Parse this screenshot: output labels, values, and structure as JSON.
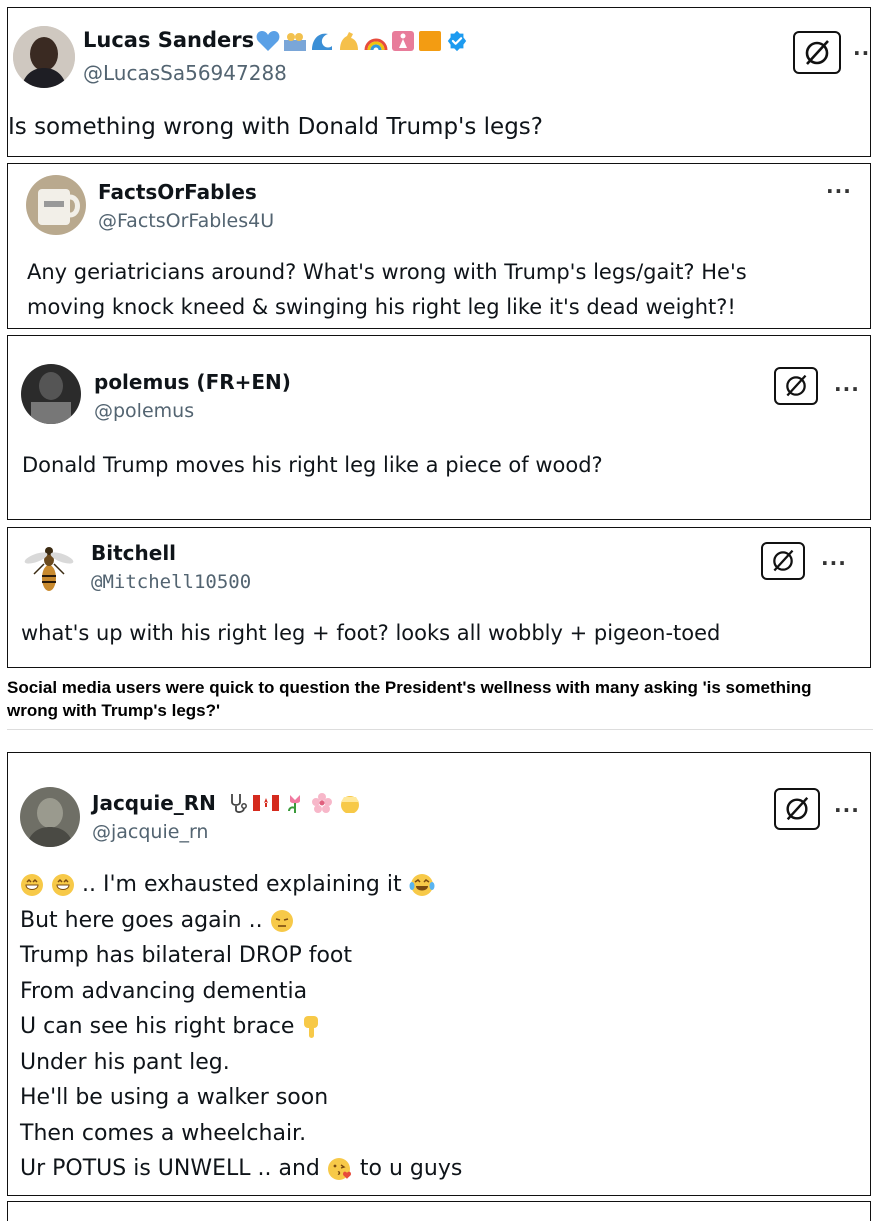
{
  "tweets": [
    {
      "name": "Lucas Sanders",
      "handle": "@LucasSa56947288",
      "text": "Is something wrong with Donald Trump's legs?"
    },
    {
      "name": "FactsOrFables",
      "handle": "@FactsOrFables4U",
      "lines": [
        "Any geriatricians around? What's wrong with Trump's legs/gait? He's",
        "moving knock kneed & swinging his right leg like it's dead weight?!"
      ]
    },
    {
      "name": "polemus (FR+EN)",
      "handle": "@polemus",
      "text": "Donald Trump moves his right leg like a piece of wood?"
    },
    {
      "name": "Bitchell",
      "handle": "@Mitchell10500",
      "text": "what's up with his right leg + foot? looks all wobbly + pigeon-toed"
    },
    {
      "name": "Jacquie_RN",
      "handle": "@jacquie_rn",
      "lines": [
        ".. I'm exhausted explaining it",
        "But here goes again ..",
        "Trump has bilateral DROP foot",
        "From advancing dementia",
        "U can see his right brace",
        "Under his pant leg.",
        "He'll be using a walker soon",
        "Then comes a wheelchair.",
        "Ur POTUS is UNWELL .. and",
        "to u guys"
      ]
    }
  ],
  "caption": "Social media users were quick to question the President's wellness with many asking 'is something wrong with Trump's legs?'",
  "icons": {
    "grok": "grok-icon",
    "more": "more-options-icon",
    "verified": "verified-badge-icon"
  },
  "colors": {
    "verified": "#1d9bf0",
    "handle": "#536471",
    "text": "#0f1419"
  }
}
